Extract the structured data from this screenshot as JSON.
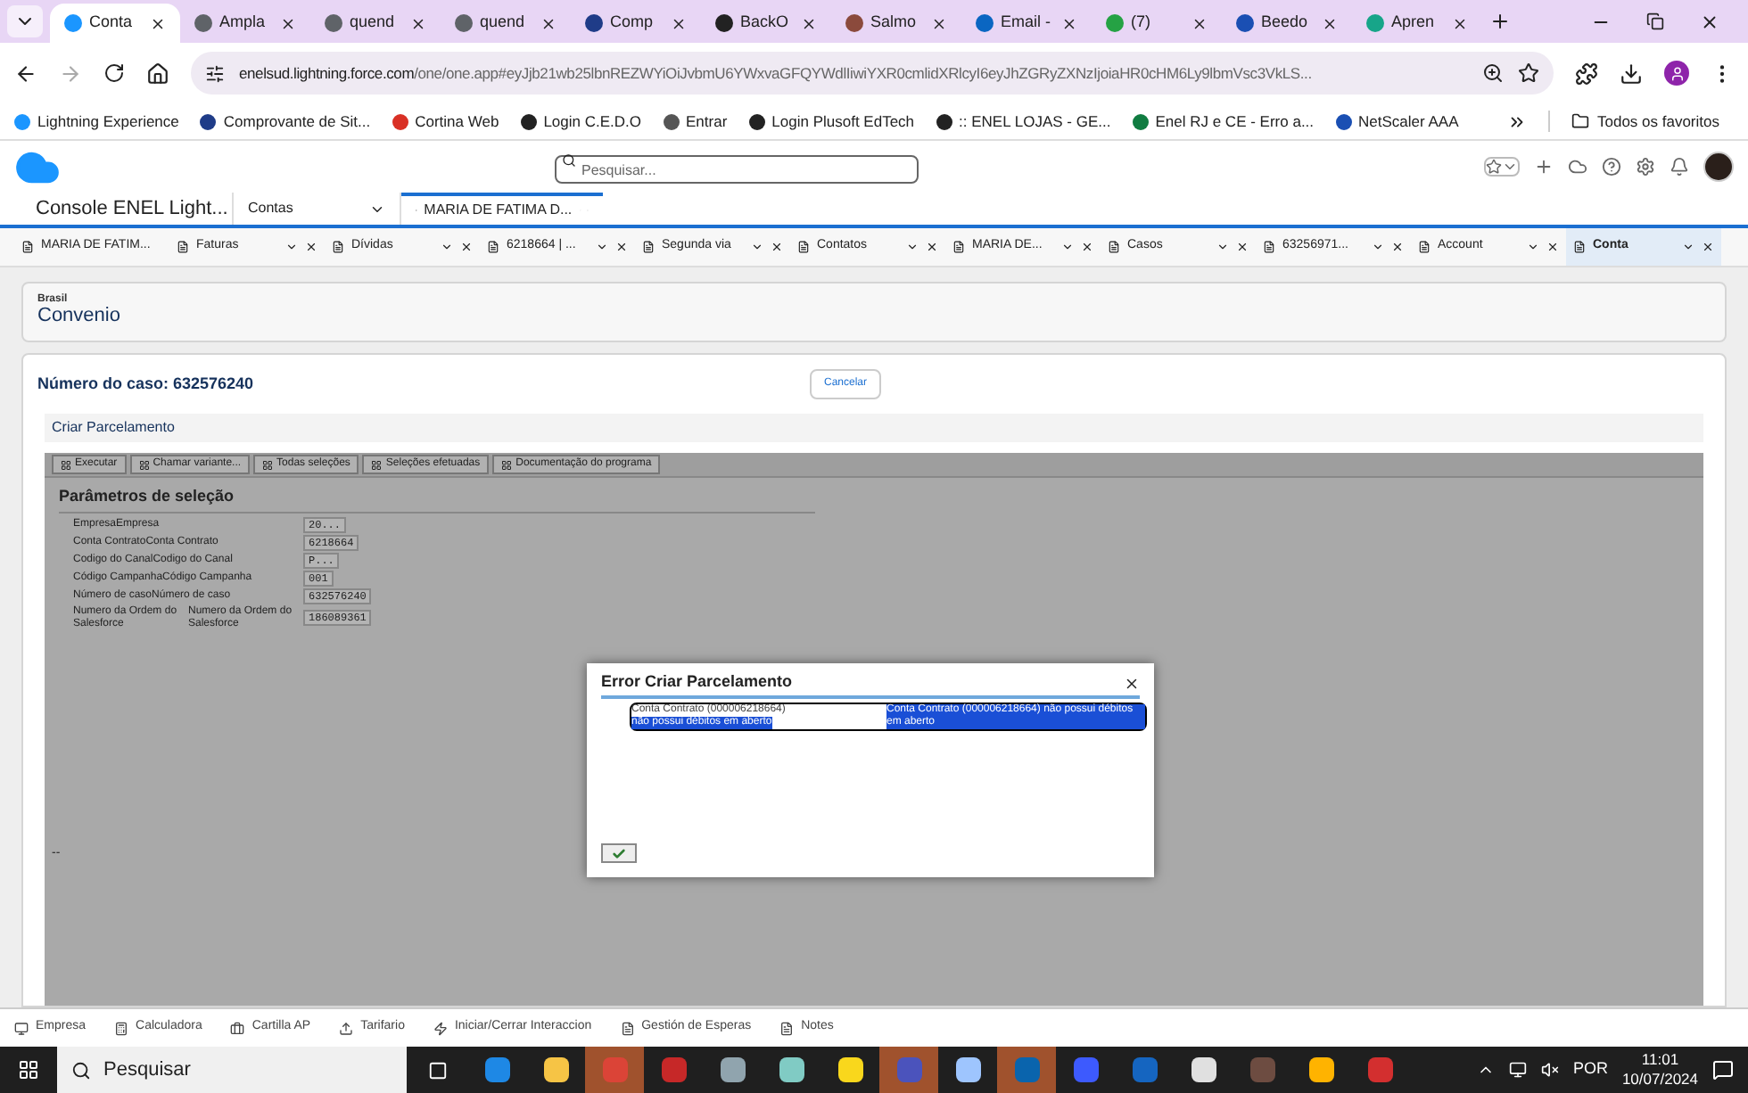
{
  "browser": {
    "tabs": [
      {
        "title": "Conta",
        "selected": true,
        "color": "#1b96ff"
      },
      {
        "title": "Ampla",
        "selected": false,
        "color": "#5f6368"
      },
      {
        "title": "quend",
        "selected": false,
        "color": "#5f6368"
      },
      {
        "title": "quend",
        "selected": false,
        "color": "#5f6368"
      },
      {
        "title": "Comp",
        "selected": false,
        "color": "#1f3c88"
      },
      {
        "title": "BackO",
        "selected": false,
        "color": "#222222"
      },
      {
        "title": "Salmo",
        "selected": false,
        "color": "#8b4a3c"
      },
      {
        "title": "Email -",
        "selected": false,
        "color": "#0a66c2"
      },
      {
        "title": "(7)",
        "selected": false,
        "color": "#25a244"
      },
      {
        "title": "Beedo",
        "selected": false,
        "color": "#1a4fb3"
      },
      {
        "title": "Apren",
        "selected": false,
        "color": "#17a589"
      }
    ],
    "url_host": "enelsud.lightning.force.com",
    "url_path": "/one/one.app#eyJjb21wb25lbnREZWYiOiJvbmU6YWxvaGFQYWdlIiwiYXR0cmlidXRlcyI6eyJhZGRyZXNzIjoiaHR0cHM6Ly9lbmVsc3VkLS...",
    "bookmarks": [
      {
        "label": "Lightning Experience",
        "color": "#1b96ff"
      },
      {
        "label": "Comprovante de Sit...",
        "color": "#1f3c88"
      },
      {
        "label": "Cortina Web",
        "color": "#d93025"
      },
      {
        "label": "Login C.E.D.O",
        "color": "#222222"
      },
      {
        "label": "Entrar",
        "color": "#555555"
      },
      {
        "label": "Login Plusoft EdTech",
        "color": "#222222"
      },
      {
        "label": ":: ENEL LOJAS - GE...",
        "color": "#222222"
      },
      {
        "label": "Enel RJ e CE - Erro a...",
        "color": "#107c41"
      },
      {
        "label": "NetScaler AAA",
        "color": "#1a4fb3"
      }
    ],
    "all_bookmarks": "Todos os favoritos"
  },
  "header": {
    "search_placeholder": "Pesquisar..."
  },
  "nav": {
    "app_name": "Console ENEL Light...",
    "object_select": "Contas",
    "workspace_tabs": [
      {
        "label": "MARIA DE FATIMA D...",
        "selected": true
      }
    ]
  },
  "subtabs": [
    {
      "label": "MARIA DE FATIM...",
      "selected": false
    },
    {
      "label": "Faturas",
      "selected": false
    },
    {
      "label": "Dívidas",
      "selected": false
    },
    {
      "label": "6218664 | ...",
      "selected": false
    },
    {
      "label": "Segunda via",
      "selected": false
    },
    {
      "label": "Contatos",
      "selected": false
    },
    {
      "label": "MARIA DE...",
      "selected": false
    },
    {
      "label": "Casos",
      "selected": false
    },
    {
      "label": "63256971...",
      "selected": false
    },
    {
      "label": "Account",
      "selected": false
    },
    {
      "label": "Conta",
      "selected": true
    }
  ],
  "record": {
    "label": "Brasil",
    "title": "Convenio"
  },
  "case": {
    "title": "Número do caso: 632576240",
    "cancel": "Cancelar",
    "section": "Criar Parcelamento"
  },
  "sap": {
    "toolbar": [
      "Executar",
      "Chamar variante...",
      "Todas seleções",
      "Seleções efetuadas",
      "Documentação do programa"
    ],
    "heading": "Parâmetros de seleção",
    "params": [
      {
        "labels": [
          "Empresa",
          "Empresa"
        ],
        "value": "20..."
      },
      {
        "labels": [
          "Conta Contrato",
          "Conta Contrato"
        ],
        "value": "6218664"
      },
      {
        "labels": [
          "Codigo do Canal",
          "Codigo do Canal"
        ],
        "value": "P..."
      },
      {
        "labels": [
          "Código Campanha",
          "Código Campanha"
        ],
        "value": "001"
      },
      {
        "labels": [
          "Número de caso",
          "Número de caso"
        ],
        "value": "632576240"
      },
      {
        "labels": [
          "Numero da Ordem do Salesforce",
          "Numero da Ordem do Salesforce"
        ],
        "value": "186089361"
      }
    ],
    "footer": "--"
  },
  "dialog": {
    "title": "Error Criar Parcelamento",
    "segments": [
      {
        "text": "Conta Contrato (000006218664)",
        "selected": false
      },
      {
        "text": "não possui débitos em aberto",
        "selected": true
      },
      {
        "text": "Conta Contrato (000006218664) não possui débitos em aberto",
        "selected": true
      }
    ]
  },
  "utility_bar": [
    "Empresa",
    "Calculadora",
    "Cartilla AP",
    "Tarifario",
    "Iniciar/Cerrar Interaccion",
    "Gestión de Esperas",
    "Notes"
  ],
  "taskbar": {
    "search_placeholder": "Pesquisar",
    "apps": [
      {
        "color": "#1e88e5",
        "active": false
      },
      {
        "color": "#f6c445",
        "active": false
      },
      {
        "color": "#db4437",
        "active": true
      },
      {
        "color": "#c62828",
        "active": false
      },
      {
        "color": "#90a4ae",
        "active": false
      },
      {
        "color": "#80cbc4",
        "active": false
      },
      {
        "color": "#f9d71c",
        "active": false
      },
      {
        "color": "#4b53bc",
        "active": true
      },
      {
        "color": "#9ec5fe",
        "active": false
      },
      {
        "color": "#0a64ad",
        "active": true
      },
      {
        "color": "#3d5afe",
        "active": false
      },
      {
        "color": "#1565c0",
        "active": false
      },
      {
        "color": "#e0e0e0",
        "active": false
      },
      {
        "color": "#6d4c41",
        "active": false
      },
      {
        "color": "#ffb300",
        "active": false
      },
      {
        "color": "#d32f2f",
        "active": false
      }
    ],
    "language": "POR",
    "time": "11:01",
    "date": "10/07/2024"
  }
}
